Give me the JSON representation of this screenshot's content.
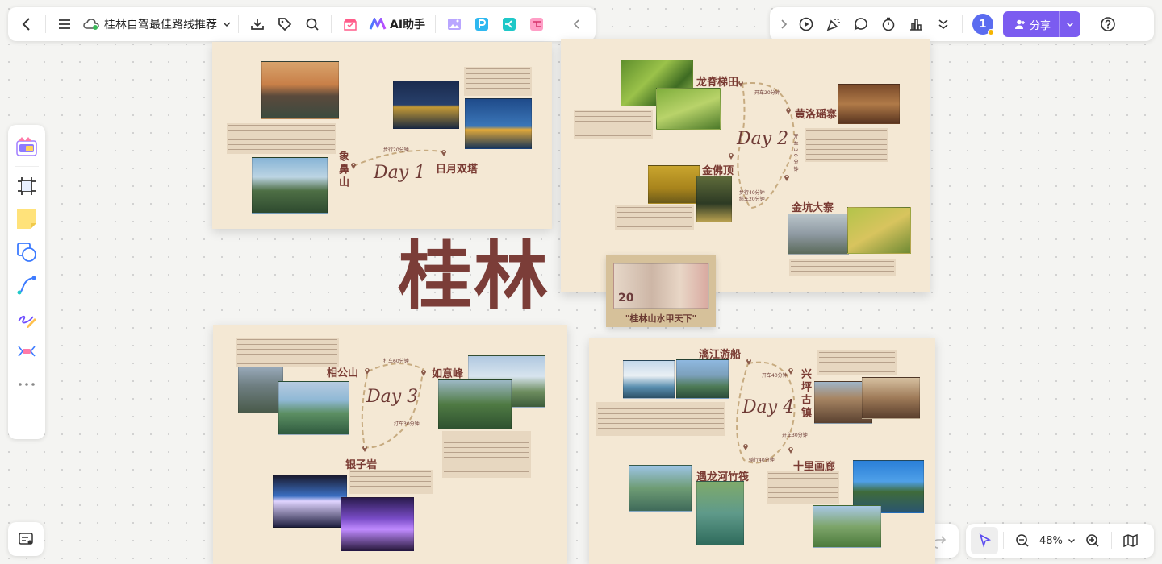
{
  "toolbar": {
    "doc_title": "桂林自驾最佳路线推荐",
    "ai_label": "AI助手"
  },
  "right_toolbar": {
    "avatar_count": "1",
    "share_label": "分享"
  },
  "zoom": {
    "level": "48%"
  },
  "board": {
    "main_title": "桂林",
    "day1": {
      "label": "Day 1",
      "place_a": "象鼻山",
      "place_b": "日月双塔",
      "time": "步行20分钟"
    },
    "day2": {
      "label": "Day 2",
      "place_a": "龙脊梯田",
      "place_b": "黄洛瑶寨",
      "place_c": "金佛顶",
      "place_d": "金坑大寨",
      "time_a": "开车20分钟",
      "time_b": "开车30分钟",
      "time_c": "步行40分钟\n缆车20分钟"
    },
    "banknote_caption": "\"桂林山水甲天下\"",
    "day3": {
      "label": "Day 3",
      "place_a": "相公山",
      "place_b": "如意峰",
      "place_c": "银子岩",
      "time_a": "打车60分钟",
      "time_b": "打车30分钟"
    },
    "day4": {
      "label": "Day 4",
      "place_a": "漓江游船",
      "place_b": "兴坪古镇",
      "place_c": "遇龙河竹筏",
      "place_d": "十里画廊",
      "time_a": "开车40分钟",
      "time_b": "开车30分钟",
      "time_c": "骑行40分钟"
    }
  },
  "colors": {
    "accent": "#7b5cf0",
    "sheet": "#f4e8d4",
    "brown": "#7a3b33"
  }
}
